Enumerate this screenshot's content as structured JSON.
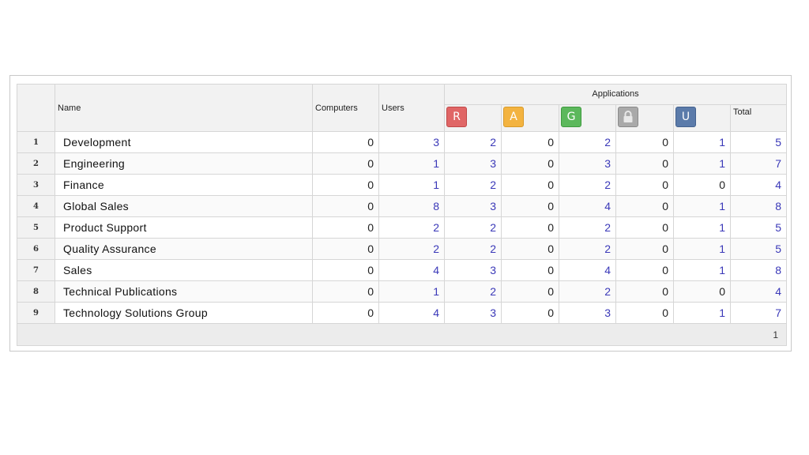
{
  "header": {
    "name": "Name",
    "computers": "Computers",
    "users": "Users",
    "applications": "Applications",
    "total": "Total",
    "icons": [
      {
        "name": "r-status-icon",
        "glyph": "R",
        "color": "#e06666"
      },
      {
        "name": "a-status-icon",
        "glyph": "A",
        "color": "#f3b340"
      },
      {
        "name": "g-status-icon",
        "glyph": "G",
        "color": "#5cb85c"
      },
      {
        "name": "lock-status-icon",
        "glyph": "",
        "color": "#a9a9a9"
      },
      {
        "name": "u-status-icon",
        "glyph": "U",
        "color": "#5b7baa"
      }
    ]
  },
  "rows": [
    {
      "num": "1",
      "name": "Development",
      "computers": "0",
      "users": "3",
      "r": "2",
      "a": "0",
      "g": "2",
      "lock": "0",
      "u": "1",
      "total": "5"
    },
    {
      "num": "2",
      "name": "Engineering",
      "computers": "0",
      "users": "1",
      "r": "3",
      "a": "0",
      "g": "3",
      "lock": "0",
      "u": "1",
      "total": "7"
    },
    {
      "num": "3",
      "name": "Finance",
      "computers": "0",
      "users": "1",
      "r": "2",
      "a": "0",
      "g": "2",
      "lock": "0",
      "u": "0",
      "total": "4"
    },
    {
      "num": "4",
      "name": "Global Sales",
      "computers": "0",
      "users": "8",
      "r": "3",
      "a": "0",
      "g": "4",
      "lock": "0",
      "u": "1",
      "total": "8"
    },
    {
      "num": "5",
      "name": "Product Support",
      "computers": "0",
      "users": "2",
      "r": "2",
      "a": "0",
      "g": "2",
      "lock": "0",
      "u": "1",
      "total": "5"
    },
    {
      "num": "6",
      "name": "Quality Assurance",
      "computers": "0",
      "users": "2",
      "r": "2",
      "a": "0",
      "g": "2",
      "lock": "0",
      "u": "1",
      "total": "5"
    },
    {
      "num": "7",
      "name": "Sales",
      "computers": "0",
      "users": "4",
      "r": "3",
      "a": "0",
      "g": "4",
      "lock": "0",
      "u": "1",
      "total": "8"
    },
    {
      "num": "8",
      "name": "Technical Publications",
      "computers": "0",
      "users": "1",
      "r": "2",
      "a": "0",
      "g": "2",
      "lock": "0",
      "u": "0",
      "total": "4"
    },
    {
      "num": "9",
      "name": "Technology Solutions Group",
      "computers": "0",
      "users": "4",
      "r": "3",
      "a": "0",
      "g": "3",
      "lock": "0",
      "u": "1",
      "total": "7"
    }
  ],
  "footer": {
    "page": "1"
  },
  "colors": {
    "link": "#3a38b8",
    "header_bg": "#f2f2f2",
    "border": "#d6d6d6"
  }
}
